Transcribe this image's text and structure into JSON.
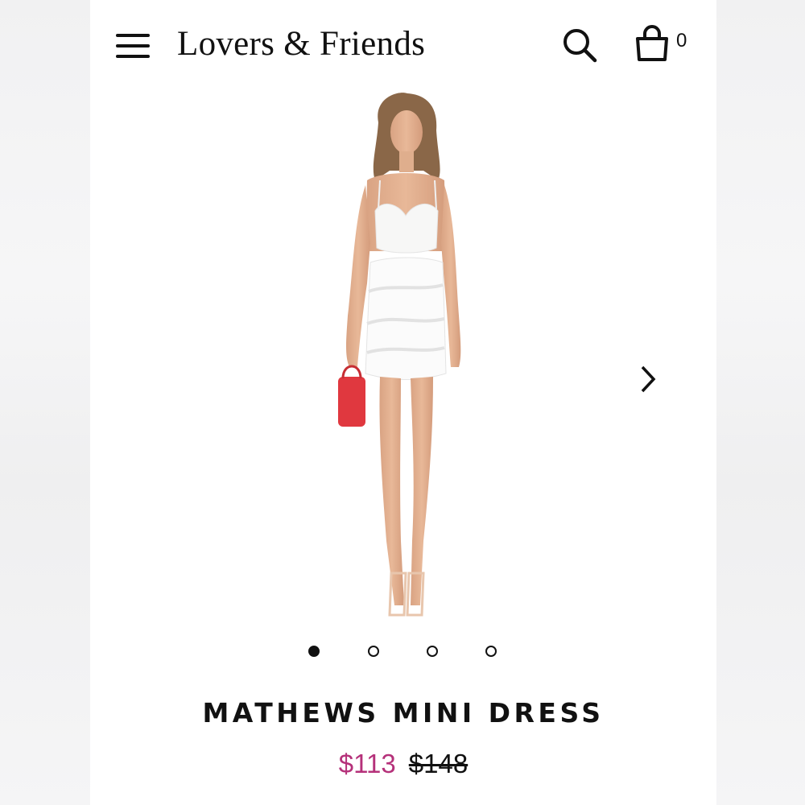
{
  "header": {
    "brand": "Lovers & Friends",
    "menu_icon": "hamburger-menu-icon",
    "search_icon": "search-icon",
    "bag_icon": "shopping-bag-icon",
    "bag_count": "0"
  },
  "gallery": {
    "image_alt": "Model wearing white ruffled mini dress holding a red handbag",
    "next_icon": "chevron-right-icon",
    "total_images": 4,
    "active_index": 0
  },
  "product": {
    "name": "MATHEWS MINI DRESS",
    "sale_price": "$113",
    "original_price": "$148"
  },
  "colors": {
    "sale_price": "#b5317a",
    "text": "#111111",
    "background": "#ffffff"
  }
}
